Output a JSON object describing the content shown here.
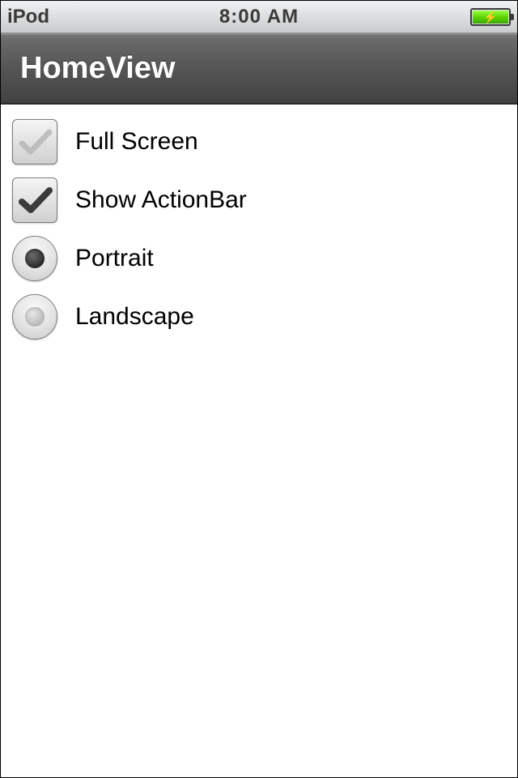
{
  "status_bar": {
    "device": "iPod",
    "time": "8:00 AM",
    "battery_charging": true
  },
  "action_bar": {
    "title": "HomeView"
  },
  "options": {
    "full_screen": {
      "label": "Full Screen",
      "checked": false
    },
    "show_actionbar": {
      "label": "Show ActionBar",
      "checked": true
    },
    "orientation": {
      "portrait_label": "Portrait",
      "landscape_label": "Landscape",
      "selected": "portrait"
    }
  }
}
